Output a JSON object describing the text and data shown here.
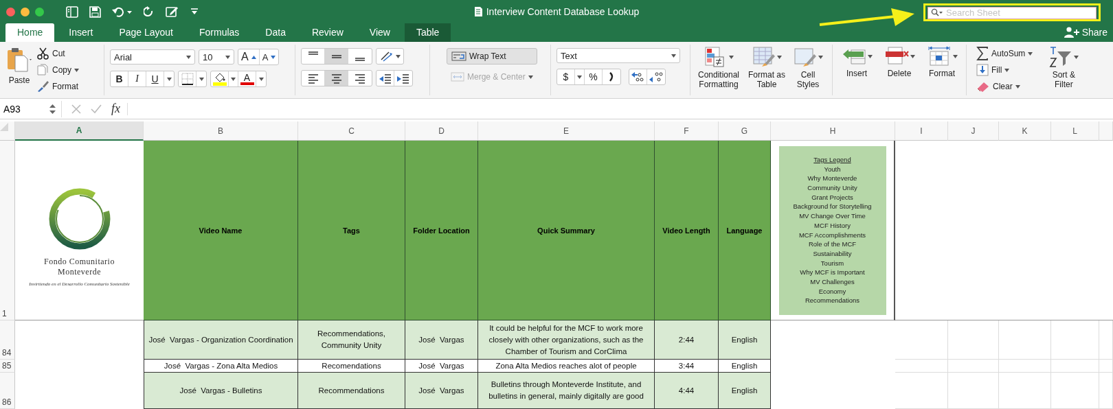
{
  "window": {
    "title": "Interview Content Database Lookup"
  },
  "search": {
    "placeholder": "Search Sheet"
  },
  "tabs": [
    {
      "label": "Home",
      "selected": true,
      "kind": "standard"
    },
    {
      "label": "Insert",
      "selected": false,
      "kind": "standard"
    },
    {
      "label": "Page Layout",
      "selected": false,
      "kind": "standard"
    },
    {
      "label": "Formulas",
      "selected": false,
      "kind": "standard"
    },
    {
      "label": "Data",
      "selected": false,
      "kind": "standard"
    },
    {
      "label": "Review",
      "selected": false,
      "kind": "standard"
    },
    {
      "label": "View",
      "selected": false,
      "kind": "standard"
    },
    {
      "label": "Table",
      "selected": false,
      "kind": "contextual"
    }
  ],
  "share": "Share",
  "clipboard": {
    "paste": "Paste",
    "cut": "Cut",
    "copy": "Copy",
    "format": "Format"
  },
  "font": {
    "name": "Arial",
    "size": "10",
    "grow": "A",
    "shrink": "A",
    "bold": "B",
    "italic": "I",
    "underline": "U",
    "color_letter": "A"
  },
  "alignment": {
    "vertical_align": [
      {
        "selected": false
      },
      {
        "selected": true
      },
      {
        "selected": false
      }
    ],
    "horizontal_align": [
      {
        "selected": false
      },
      {
        "selected": true
      },
      {
        "selected": false
      }
    ],
    "wrap_text": {
      "label": "Wrap Text",
      "selected": true
    },
    "merge_center": {
      "label": "Merge & Center",
      "disabled": true
    }
  },
  "number": {
    "format": "Text",
    "currency": "$",
    "percent": "%"
  },
  "styles": [
    {
      "label": "Conditional Formatting",
      "kind": "conditional"
    },
    {
      "label": "Format as Table",
      "kind": "table"
    },
    {
      "label": "Cell Styles",
      "kind": "cell"
    }
  ],
  "cells": [
    {
      "label": "Insert",
      "kind": "insert"
    },
    {
      "label": "Delete",
      "kind": "delete"
    },
    {
      "label": "Format",
      "kind": "format"
    }
  ],
  "editing": {
    "autosum": "AutoSum",
    "fill": "Fill",
    "clear": "Clear",
    "sort_filter": "Sort & Filter"
  },
  "formula_bar": {
    "cell_ref": "A93",
    "fx": "fx"
  },
  "sheet": {
    "column_headers": [
      {
        "label": "A",
        "selected": true
      },
      {
        "label": "B",
        "selected": false
      },
      {
        "label": "C",
        "selected": false
      },
      {
        "label": "D",
        "selected": false
      },
      {
        "label": "E",
        "selected": false
      },
      {
        "label": "F",
        "selected": false
      },
      {
        "label": "G",
        "selected": false
      },
      {
        "label": "H",
        "selected": false
      },
      {
        "label": "I",
        "selected": false
      },
      {
        "label": "J",
        "selected": false
      },
      {
        "label": "K",
        "selected": false
      },
      {
        "label": "L",
        "selected": false
      }
    ],
    "header_row_number": "1",
    "logo": {
      "name_lines": [
        "Fondo Comunitario",
        "Monteverde"
      ],
      "tagline": "Invirtiendo en el Desarrollo Comunitario Sostenible"
    },
    "header": [
      "Video Name",
      "Tags",
      "Folder Location",
      "Quick Summary",
      "Video Length",
      "Language"
    ],
    "legend": {
      "title": "Tags Legend",
      "items": [
        "Youth",
        "Why Monteverde",
        "Community Unity",
        "Grant Projects",
        "Background for Storytelling",
        "MV Change Over Time",
        "MCF History",
        "MCF Accomplishments",
        "Role of the MCF",
        "Sustainability",
        "Tourism",
        "Why MCF is Important",
        "MV Challenges",
        "Economy",
        "Recommendations"
      ]
    },
    "rows": [
      {
        "number": "84",
        "banded": true,
        "cells": [
          "José  Vargas - Organization Coordination",
          "Recommendations, Community Unity",
          "José  Vargas",
          "It could be helpful for the MCF to work more closely with other organizations, such as the Chamber of Tourism and CorClima",
          "2:44",
          "English"
        ]
      },
      {
        "number": "85",
        "banded": false,
        "cells": [
          "José  Vargas - Zona Alta Medios",
          "Recomendations",
          "José  Vargas",
          "Zona Alta Medios reaches alot of people",
          "3:44",
          "English"
        ]
      },
      {
        "number": "86",
        "banded": true,
        "cells": [
          "José  Vargas - Bulletins",
          "Recommendations",
          "José  Vargas",
          "Bulletins through Monteverde Institute, and bulletins in general, mainly digitally are good",
          "4:44",
          "English"
        ]
      }
    ]
  }
}
